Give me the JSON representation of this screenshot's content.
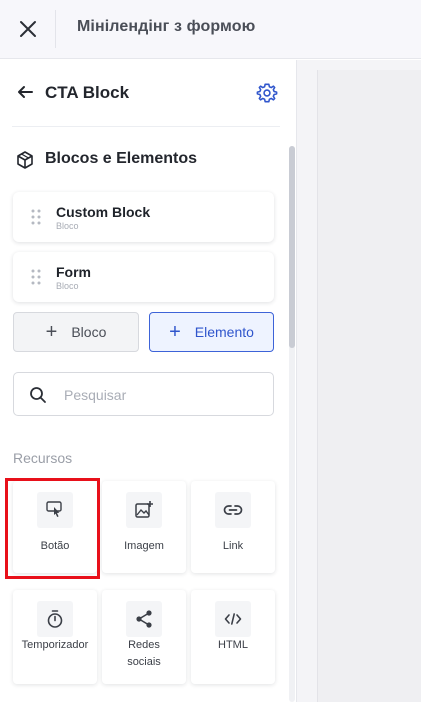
{
  "topbar": {
    "title": "Мінілендінг з формою"
  },
  "panel": {
    "header": {
      "title": "CTA Block"
    },
    "section": {
      "title": "Blocos e Elementos"
    },
    "blocks": [
      {
        "name": "Custom Block",
        "type": "Bloco"
      },
      {
        "name": "Form",
        "type": "Bloco"
      }
    ],
    "buttons": {
      "add_block": "Bloco",
      "add_element": "Elemento",
      "plus_glyph": "+"
    },
    "search": {
      "placeholder": "Pesquisar",
      "value": ""
    },
    "resources": {
      "title": "Recursos",
      "items": [
        {
          "label": "Botão",
          "icon": "button-pointer-icon"
        },
        {
          "label": "Imagem",
          "icon": "image-add-icon"
        },
        {
          "label": "Link",
          "icon": "link-icon"
        },
        {
          "label": "Temporizador",
          "icon": "timer-icon"
        },
        {
          "label": "Redes sociais",
          "icon": "share-icon"
        },
        {
          "label": "HTML",
          "icon": "code-icon"
        }
      ]
    }
  },
  "colors": {
    "accent": "#2f55cc",
    "highlight": "#e8101a",
    "topbar_bg": "#f7f7fb"
  }
}
